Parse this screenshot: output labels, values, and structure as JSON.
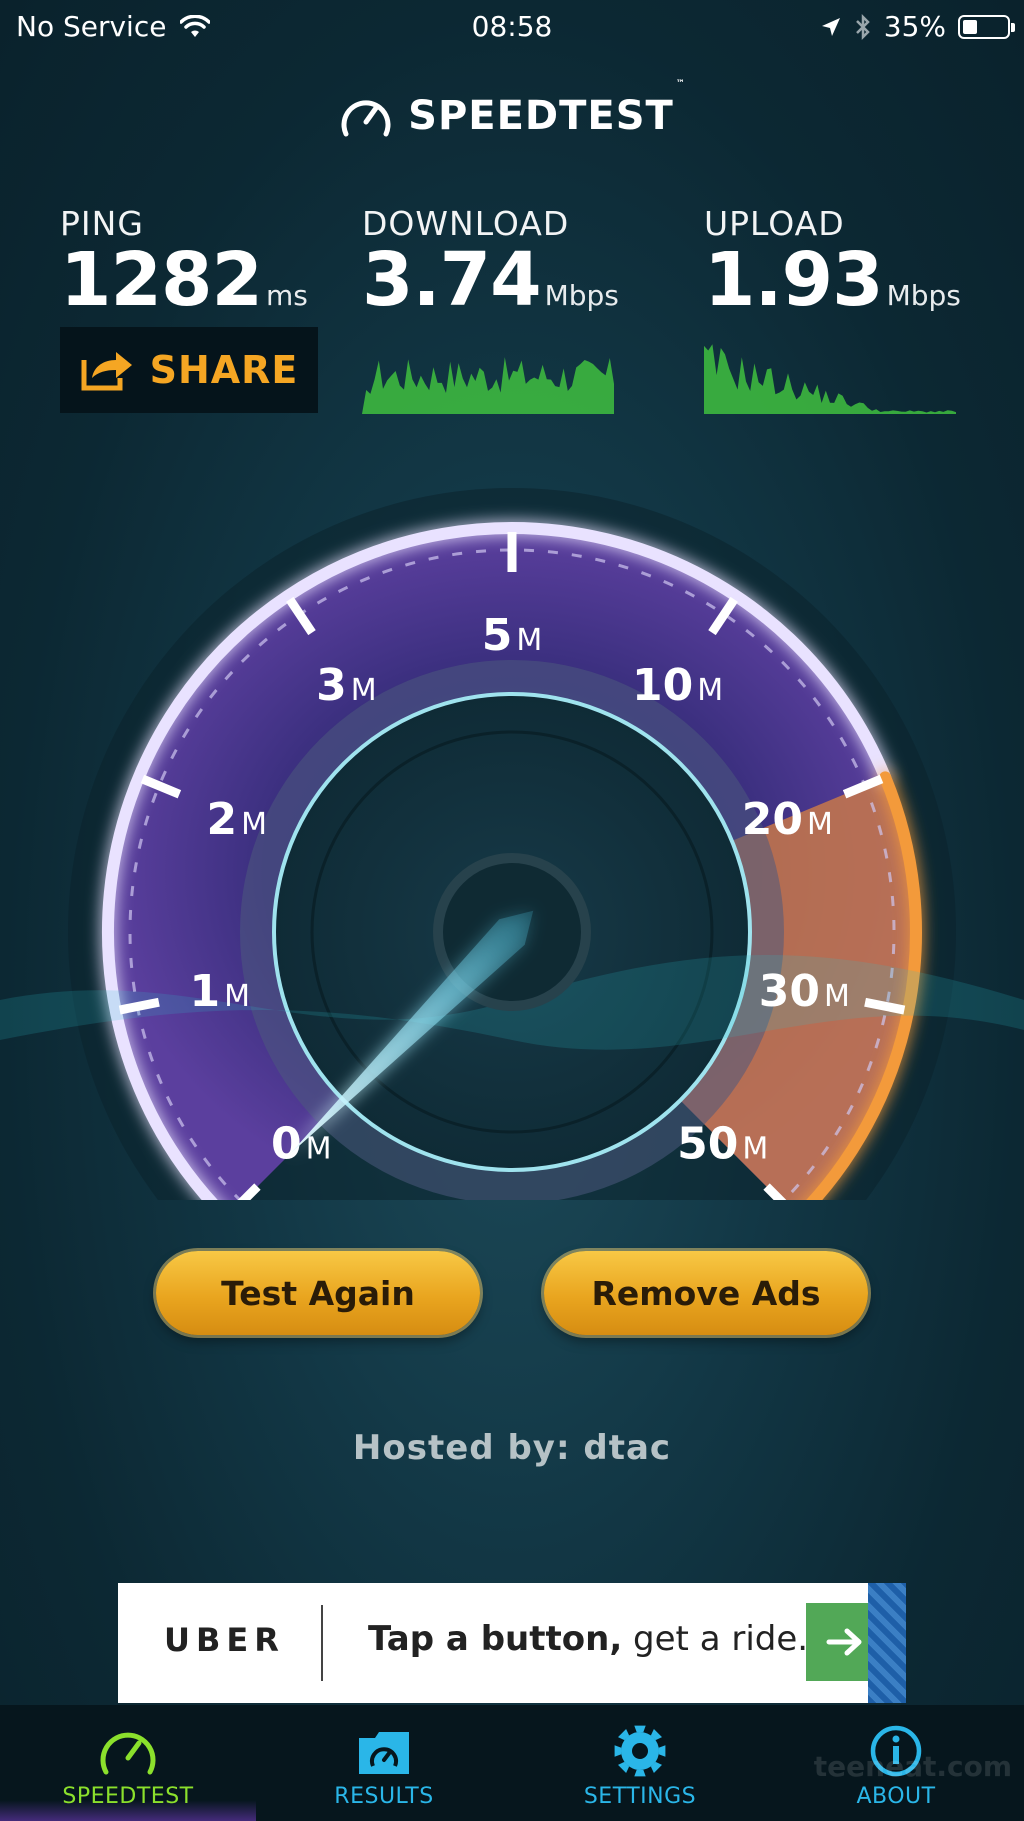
{
  "status_bar": {
    "carrier": "No Service",
    "time": "08:58",
    "battery": "35%",
    "battery_level": 0.35
  },
  "header": {
    "title": "SPEEDTEST",
    "tm": "™"
  },
  "stats": {
    "ping": {
      "label": "PING",
      "value": "1282",
      "unit": "ms"
    },
    "download": {
      "label": "DOWNLOAD",
      "value": "3.74",
      "unit": "Mbps"
    },
    "upload": {
      "label": "UPLOAD",
      "value": "1.93",
      "unit": "Mbps"
    }
  },
  "share": {
    "label": "SHARE"
  },
  "gauge": {
    "ticks": [
      {
        "num": "0",
        "unit": "M"
      },
      {
        "num": "1",
        "unit": "M"
      },
      {
        "num": "2",
        "unit": "M"
      },
      {
        "num": "3",
        "unit": "M"
      },
      {
        "num": "5",
        "unit": "M"
      },
      {
        "num": "10",
        "unit": "M"
      },
      {
        "num": "20",
        "unit": "M"
      },
      {
        "num": "30",
        "unit": "M"
      },
      {
        "num": "50",
        "unit": "M"
      }
    ],
    "needle_value_mbps": 0
  },
  "buttons": {
    "test_again": "Test Again",
    "remove_ads": "Remove Ads"
  },
  "hosted": "Hosted by: dtac",
  "ad": {
    "brand": "UBER",
    "tagline_bold": "Tap a button,",
    "tagline_rest": " get a ride."
  },
  "nav": {
    "items": [
      {
        "label": "SPEEDTEST",
        "color": "#8be02c"
      },
      {
        "label": "RESULTS",
        "color": "#2ab6e8"
      },
      {
        "label": "SETTINGS",
        "color": "#2ab6e8"
      },
      {
        "label": "ABOUT",
        "color": "#2ab6e8"
      }
    ]
  },
  "watermark": "teeneat.com",
  "colors": {
    "accent_orange": "#f5a623",
    "graph_green": "#3fbf3f",
    "gauge_purple": "#5a3e9a",
    "gauge_orange": "#f39a3a"
  }
}
